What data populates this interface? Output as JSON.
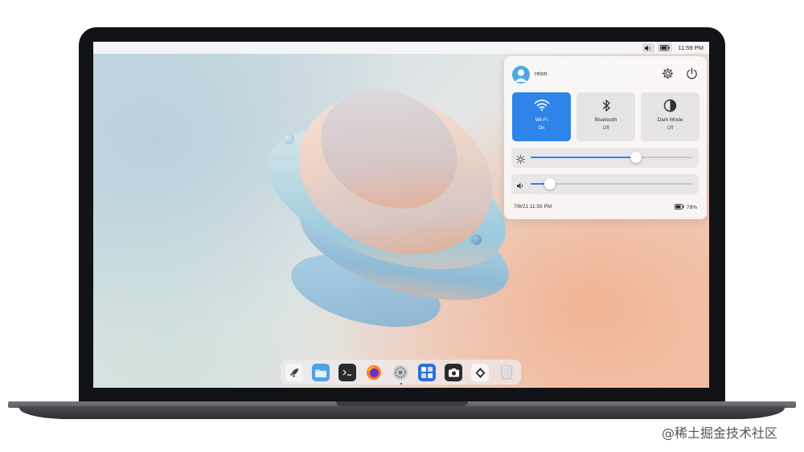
{
  "topbar": {
    "time": "11:59 PM",
    "volume_icon": "volume-icon",
    "battery_icon": "battery-icon"
  },
  "control_center": {
    "username": "reion",
    "settings_icon": "gear-icon",
    "power_icon": "power-icon",
    "tiles": [
      {
        "label": "Wi-Fi",
        "state": "On",
        "icon": "wifi-icon",
        "active": true
      },
      {
        "label": "Bluetooth",
        "state": "Off",
        "icon": "bluetooth-icon",
        "active": false
      },
      {
        "label": "Dark Mode",
        "state": "Off",
        "icon": "dark-mode-icon",
        "active": false
      }
    ],
    "brightness": {
      "icon": "sun-icon",
      "value": 0.65
    },
    "volume": {
      "icon": "speaker-icon",
      "value": 0.12
    },
    "datetime": "7/8/21 11:59 PM",
    "battery": "78%"
  },
  "dock": {
    "items": [
      "launcher-icon",
      "files-icon",
      "terminal-icon",
      "firefox-icon",
      "settings-icon",
      "calculator-icon",
      "screenshot-icon",
      "store-icon",
      "trash-icon"
    ]
  },
  "watermark": "@稀土掘金技术社区",
  "colors": {
    "accent": "#2e84e8",
    "avatar": "#4aa8e6"
  }
}
